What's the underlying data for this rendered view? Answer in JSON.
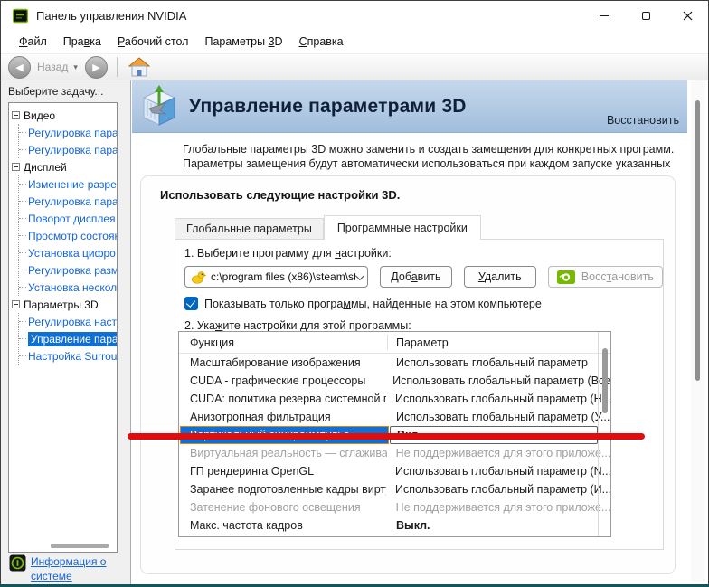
{
  "window": {
    "title": "Панель управления NVIDIA"
  },
  "menu": {
    "items": [
      {
        "pre": "",
        "key": "Ф",
        "post": "айл"
      },
      {
        "pre": "Пра",
        "key": "в",
        "post": "ка"
      },
      {
        "pre": "",
        "key": "Р",
        "post": "абочий стол"
      },
      {
        "pre": "Параметры ",
        "key": "3",
        "post": "D"
      },
      {
        "pre": "",
        "key": "С",
        "post": "правка"
      }
    ]
  },
  "toolbar": {
    "back_label": "Назад",
    "back_glyph": "◀",
    "forward_glyph": "▶",
    "caret_glyph": "▾"
  },
  "sidebar": {
    "header": "Выберите задачу...",
    "tree": [
      {
        "label": "Видео",
        "kind": "group"
      },
      {
        "label": "Регулировка пара",
        "kind": "leaf"
      },
      {
        "label": "Регулировка пара",
        "kind": "leaf"
      },
      {
        "label": "Дисплей",
        "kind": "group"
      },
      {
        "label": "Изменение разреш",
        "kind": "leaf"
      },
      {
        "label": "Регулировка пара",
        "kind": "leaf"
      },
      {
        "label": "Поворот дисплея",
        "kind": "leaf"
      },
      {
        "label": "Просмотр состоян",
        "kind": "leaf"
      },
      {
        "label": "Установка цифро",
        "kind": "leaf"
      },
      {
        "label": "Регулировка разм",
        "kind": "leaf"
      },
      {
        "label": "Установка нескол",
        "kind": "leaf"
      },
      {
        "label": "Параметры 3D",
        "kind": "group"
      },
      {
        "label": "Регулировка наст",
        "kind": "leaf"
      },
      {
        "label": "Управление пара",
        "kind": "leaf",
        "selected": true
      },
      {
        "label": "Настройка Surrou",
        "kind": "leaf"
      }
    ],
    "footer_link": "Информация о системе"
  },
  "main": {
    "banner": {
      "title": "Управление параметрами 3D",
      "restore_link": "Восстановить"
    },
    "intro": "Глобальные параметры 3D можно заменить и создать замещения для конкретных программ. Параметры замещения будут автоматически использоваться при каждом запуске указанных программ.",
    "section_heading": "Использовать следующие настройки 3D.",
    "tabs": [
      {
        "label": "Глобальные параметры"
      },
      {
        "label": "Программные настройки"
      }
    ],
    "program": {
      "label": {
        "pre": "1. Выберите программу для ",
        "key": "н",
        "post": "астройки:"
      },
      "value": "c:\\program files (x86)\\steam\\st...",
      "add": {
        "pre": "Доб",
        "key": "а",
        "post": "вить"
      },
      "remove": {
        "pre": "",
        "key": "У",
        "post": "далить"
      },
      "restore": {
        "pre": "Восс",
        "key": "т",
        "post": "ановить"
      }
    },
    "show_only": {
      "pre": "Показывать только програ",
      "key": "м",
      "post": "мы, найденные на этом компьютере",
      "checked": true
    },
    "settings_label": {
      "pre": "2. Ука",
      "key": "ж",
      "post": "ите настройки для этой программы:"
    },
    "table": {
      "columns": [
        "Функция",
        "Параметр"
      ],
      "rows": [
        {
          "feature": "Масштабирование изображения",
          "value": "Использовать глобальный параметр",
          "state": "normal"
        },
        {
          "feature": "CUDA - графические процессоры",
          "value": "Использовать глобальный параметр (Все)",
          "state": "normal"
        },
        {
          "feature": "CUDA: политика резерва системной пам...",
          "value": "Использовать глобальный параметр (Н...",
          "state": "normal"
        },
        {
          "feature": "Анизотропная фильтрация",
          "value": "Использовать глобальный параметр (У...",
          "state": "normal"
        },
        {
          "feature": "Вертикальный синхроимпульс",
          "value": "Вкл",
          "state": "selected"
        },
        {
          "feature": "Виртуальная реальность — сглаживан...",
          "value": "Не поддерживается для этого приложе...",
          "state": "disabled"
        },
        {
          "feature": "ГП рендеринга OpenGL",
          "value": "Использовать глобальный параметр (N...",
          "state": "normal"
        },
        {
          "feature": "Заранее подготовленные кадры вирту...",
          "value": "Использовать глобальный параметр (И...",
          "state": "normal"
        },
        {
          "feature": "Затенение фонового освещения",
          "value": "Не поддерживается для этого приложе...",
          "state": "disabled"
        },
        {
          "feature": "Макс. частота кадров",
          "value": "Выкл.",
          "state": "bold"
        }
      ]
    }
  },
  "annotation": {
    "underline_color": "#e00d0d"
  },
  "colors": {
    "selection_blue": "#0f6fd3",
    "link_blue": "#1565d8",
    "nvidia_green": "#76b900",
    "banner_top": "#c6d8eb",
    "banner_bottom": "#a1bedd"
  }
}
